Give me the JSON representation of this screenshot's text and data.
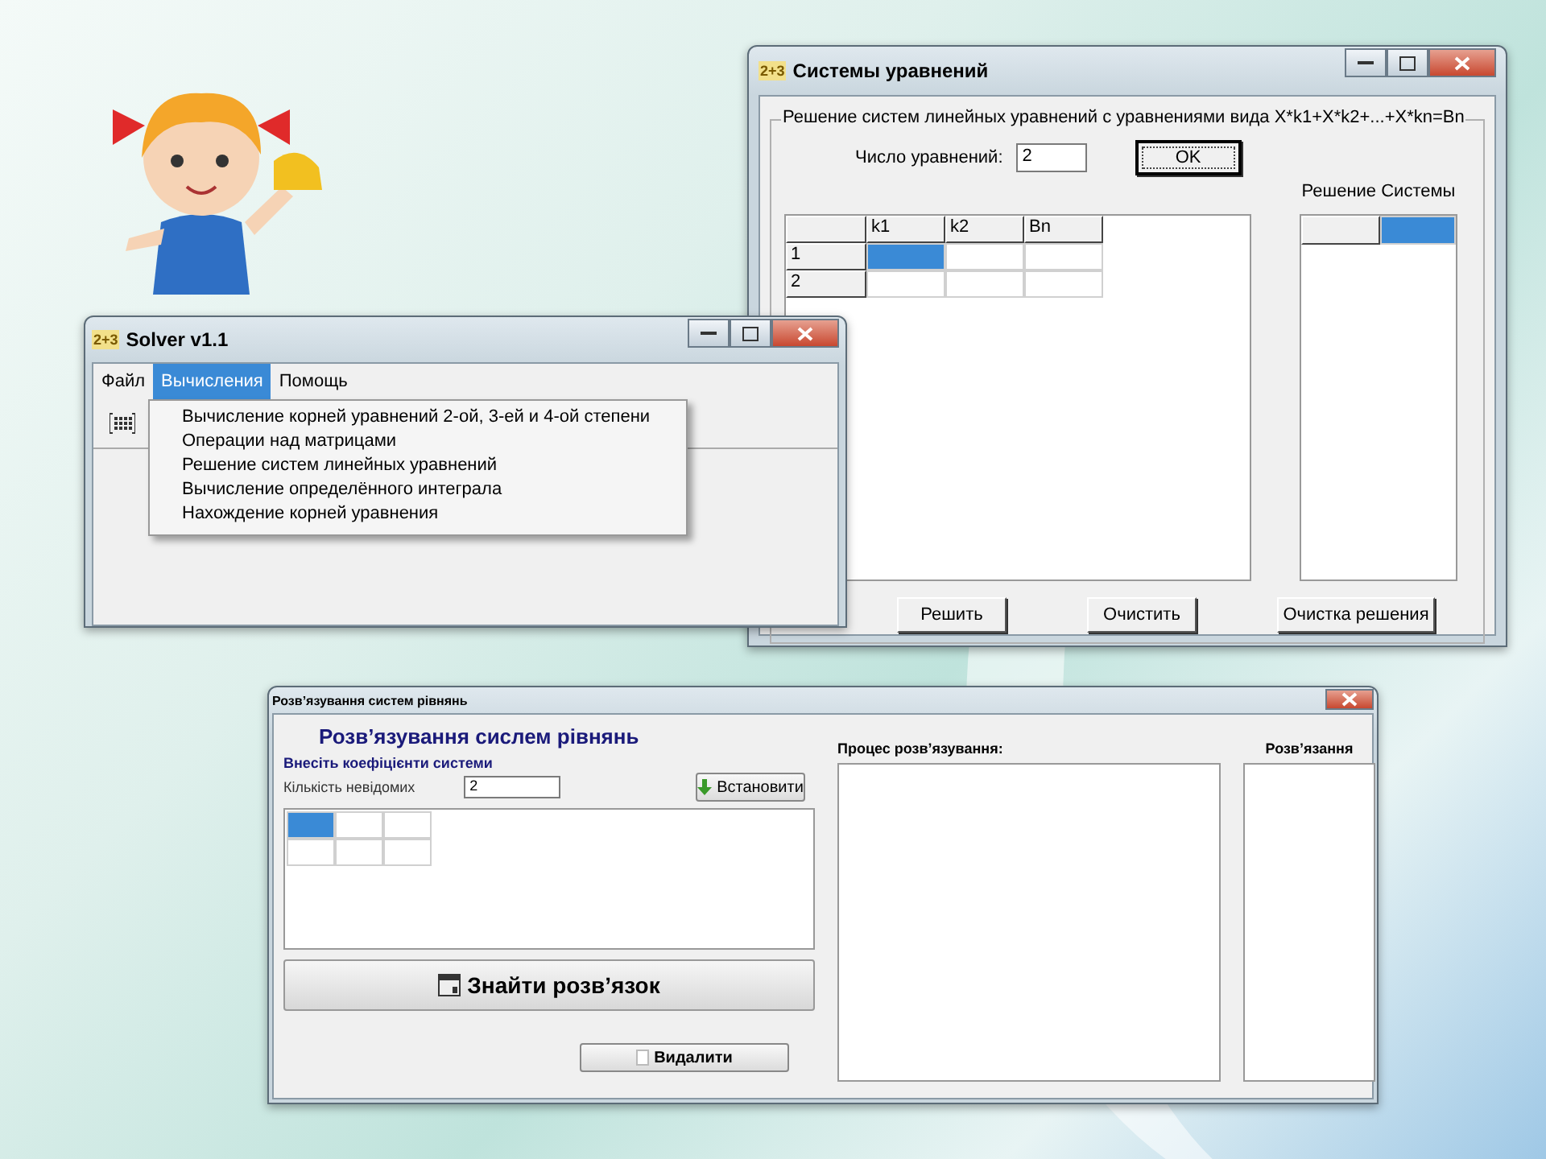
{
  "systems_window": {
    "app_icon": "2+3",
    "title": "Системы уравнений",
    "group_title": "Решение систем линейных уравнений с уравнениями вида X*k1+X*k2+...+X*kn=Bn",
    "count_label": "Число уравнений:",
    "count_value": "2",
    "ok_button": "OK",
    "table": {
      "columns": [
        "k1",
        "k2",
        "Bn"
      ],
      "rows": [
        {
          "label": "1",
          "cells": [
            {
              "selected": true
            },
            {
              "selected": false
            },
            {
              "selected": false
            }
          ]
        },
        {
          "label": "2",
          "cells": [
            {
              "selected": false
            },
            {
              "selected": false
            },
            {
              "selected": false
            }
          ]
        }
      ]
    },
    "solution_title": "Решение Системы",
    "solution_header": [
      {
        "selected": false
      },
      {
        "selected": true
      }
    ],
    "buttons": [
      "Решить",
      "Очистить",
      "Очистка решения"
    ]
  },
  "solver_window": {
    "app_icon": "2+3",
    "title": "Solver v1.1",
    "menu": [
      {
        "label": "Файл",
        "selected": false
      },
      {
        "label": "Вычисления",
        "selected": true
      },
      {
        "label": "Помощь",
        "selected": false
      }
    ],
    "dropdown": [
      "Вычисление корней уравнений 2-ой, 3-ей и 4-ой степени",
      "Операции над матрицами",
      "Решение систем линейных уравнений",
      "Вычисление определённого интеграла",
      "Нахождение корней уравнения"
    ]
  },
  "ukr_window": {
    "title": "Розв’язування систем рівнянь",
    "heading": "Розв’язування сислем рівнянь",
    "subheading": "Внесіть коефіцієнти системи",
    "count_label": "Кількість невідомих",
    "count_value": "2",
    "set_button": "Встановити",
    "grid": [
      [
        {
          "selected": true
        },
        {
          "selected": false
        },
        {
          "selected": false
        }
      ],
      [
        {
          "selected": false
        },
        {
          "selected": false
        },
        {
          "selected": false
        }
      ]
    ],
    "find_button": "Знайти розв’язок",
    "delete_button": "Видалити",
    "process_label": "Процес розв’язування:",
    "result_label": "Розв’язання"
  }
}
